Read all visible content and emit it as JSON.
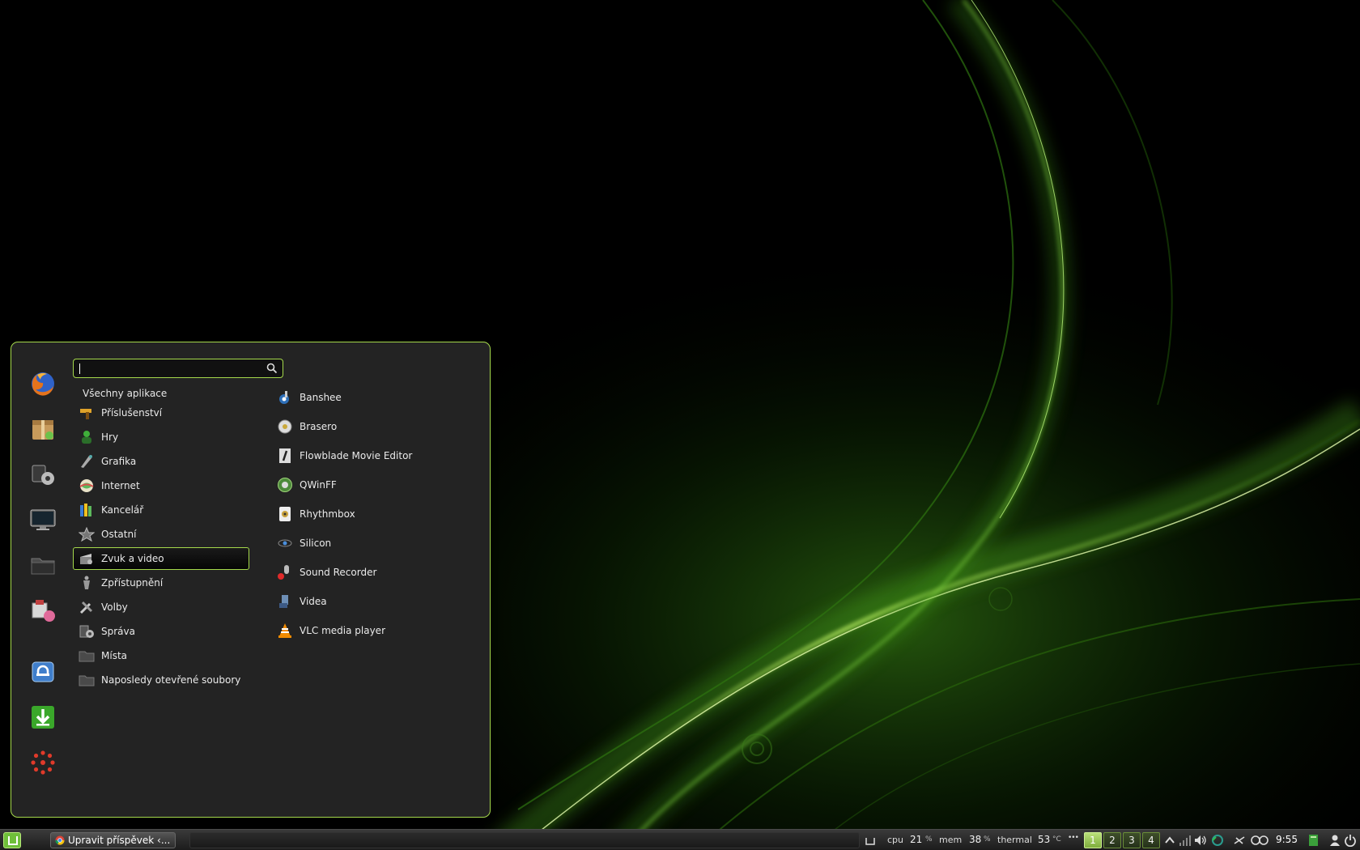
{
  "search": {
    "value": "",
    "placeholder": ""
  },
  "menu": {
    "all_apps_label": "Všechny aplikace",
    "favorites": [
      {
        "icon": "firefox-icon"
      },
      {
        "icon": "software-package-icon"
      },
      {
        "icon": "system-settings-icon"
      },
      {
        "icon": "terminal-icon"
      },
      {
        "icon": "file-manager-folder-icon"
      },
      {
        "icon": "package-manager-icon"
      },
      {
        "icon": "lock-screen-icon"
      },
      {
        "icon": "download-logout-icon"
      },
      {
        "icon": "shutdown-icon"
      }
    ],
    "categories": [
      {
        "label": "Příslušenství",
        "icon": "accessories-icon"
      },
      {
        "label": "Hry",
        "icon": "games-icon"
      },
      {
        "label": "Grafika",
        "icon": "graphics-icon"
      },
      {
        "label": "Internet",
        "icon": "internet-icon"
      },
      {
        "label": "Kancelář",
        "icon": "office-icon"
      },
      {
        "label": "Ostatní",
        "icon": "other-icon"
      },
      {
        "label": "Zvuk a video",
        "icon": "sound-video-icon",
        "active": true
      },
      {
        "label": "Zpřístupnění",
        "icon": "accessibility-icon"
      },
      {
        "label": "Volby",
        "icon": "preferences-icon"
      },
      {
        "label": "Správa",
        "icon": "administration-icon"
      },
      {
        "label": "Místa",
        "icon": "places-folder-icon"
      },
      {
        "label": "Naposledy otevřené soubory",
        "icon": "recent-files-folder-icon"
      }
    ],
    "apps": [
      {
        "label": "Banshee",
        "icon": "banshee-icon"
      },
      {
        "label": "Brasero",
        "icon": "brasero-icon"
      },
      {
        "label": "Flowblade Movie Editor",
        "icon": "flowblade-icon"
      },
      {
        "label": "QWinFF",
        "icon": "qwinff-icon"
      },
      {
        "label": "Rhythmbox",
        "icon": "rhythmbox-icon"
      },
      {
        "label": "Silicon",
        "icon": "silicon-icon"
      },
      {
        "label": "Sound Recorder",
        "icon": "sound-recorder-icon"
      },
      {
        "label": "Videa",
        "icon": "videos-icon"
      },
      {
        "label": "VLC media player",
        "icon": "vlc-icon"
      }
    ]
  },
  "panel": {
    "window_title": "Upravit příspěvek ‹...",
    "cpu_label": "cpu",
    "cpu_value": "21",
    "cpu_unit": "%",
    "mem_label": "mem",
    "mem_value": "38",
    "mem_unit": "%",
    "thermal_label": "thermal",
    "thermal_value": "53",
    "thermal_unit": "°C",
    "more_label": "•••",
    "workspaces": [
      "1",
      "2",
      "3",
      "4"
    ],
    "active_workspace": "1",
    "clock": "9:55"
  },
  "colors": {
    "accent": "#a5d94b",
    "menu_bg": "#232323"
  }
}
